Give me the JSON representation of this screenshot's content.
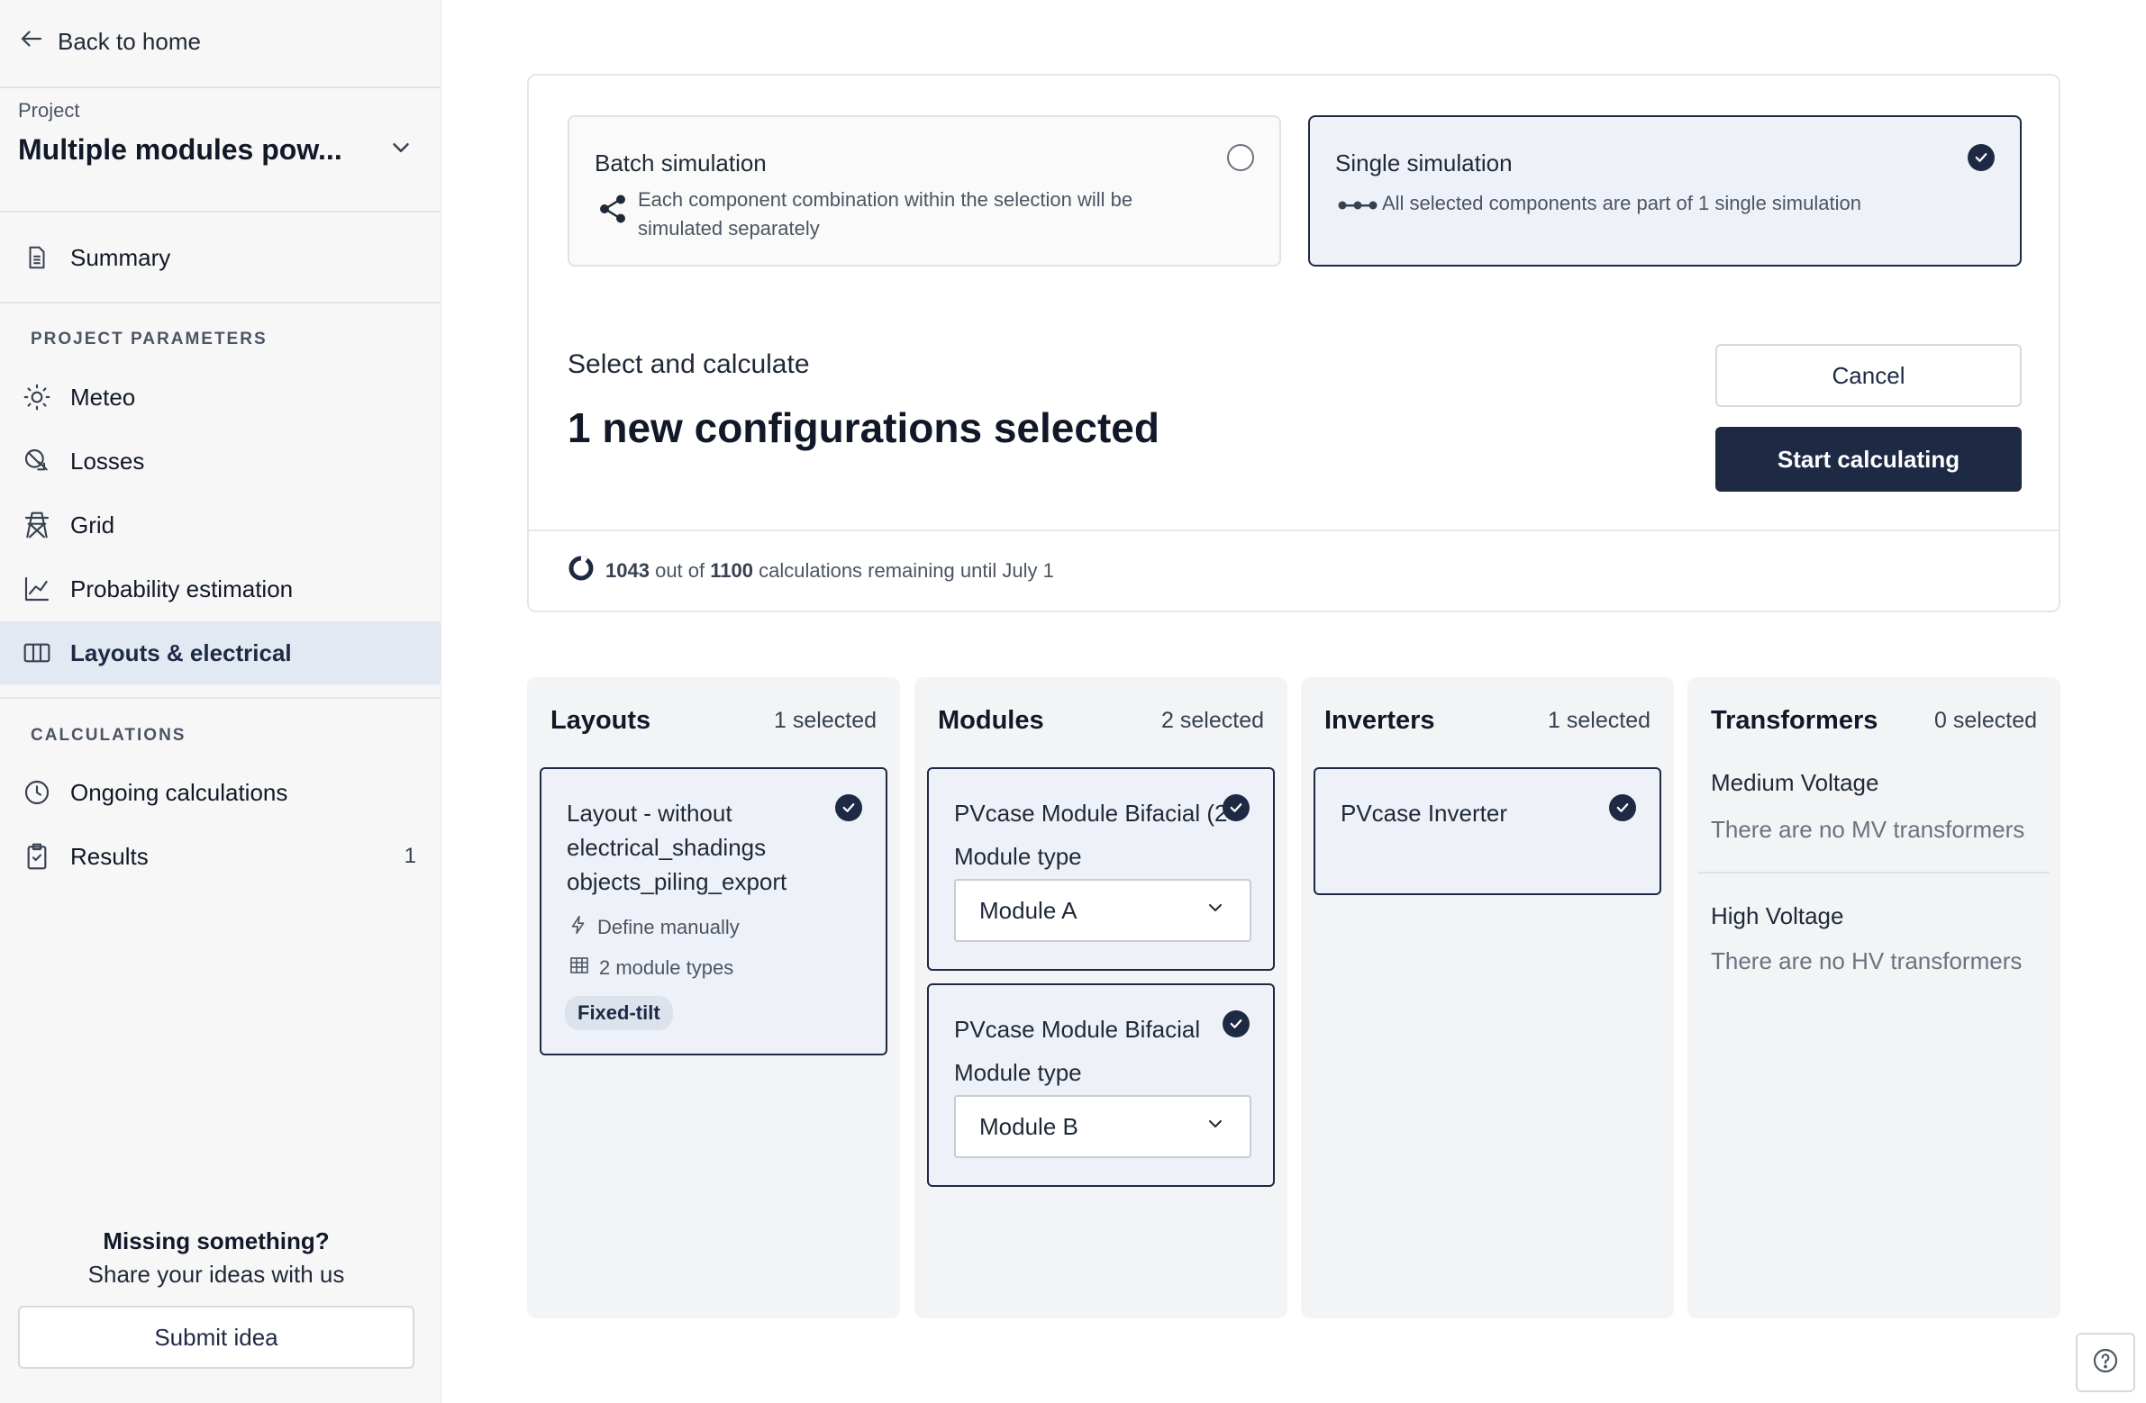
{
  "sidebar": {
    "back_label": "Back to home",
    "project_caption": "Project",
    "project_name": "Multiple modules pow...",
    "summary_label": "Summary",
    "params_section": "PROJECT PARAMETERS",
    "params": [
      {
        "label": "Meteo",
        "icon": "sun-icon"
      },
      {
        "label": "Losses",
        "icon": "losses-icon"
      },
      {
        "label": "Grid",
        "icon": "power-tower-icon"
      },
      {
        "label": "Probability estimation",
        "icon": "line-chart-icon"
      },
      {
        "label": "Layouts & electrical",
        "icon": "columns-icon",
        "active": true
      }
    ],
    "calc_section": "CALCULATIONS",
    "calcs": [
      {
        "label": "Ongoing calculations",
        "icon": "clock-icon"
      },
      {
        "label": "Results",
        "icon": "clipboard-check-icon",
        "count": "1"
      }
    ],
    "missing_title": "Missing something?",
    "missing_sub": "Share your ideas with us",
    "submit_label": "Submit idea"
  },
  "simulation": {
    "batch": {
      "title": "Batch simulation",
      "desc": "Each component combination within the selection will be simulated separately",
      "selected": false
    },
    "single": {
      "title": "Single simulation",
      "desc": "All selected components are part of 1 single simulation",
      "selected": true
    }
  },
  "calculate": {
    "label": "Select and calculate",
    "count_text": "1 new configurations selected",
    "cancel_label": "Cancel",
    "start_label": "Start calculating"
  },
  "quota": {
    "used": "1043",
    "out_of": "out of",
    "total": "1100",
    "suffix": "calculations remaining until July 1"
  },
  "columns": {
    "layouts": {
      "title": "Layouts",
      "count": "1 selected",
      "item": {
        "title": "Layout - without electrical_shadings objects_piling_export",
        "define": "Define manually",
        "module_types": "2 module types",
        "tag": "Fixed-tilt"
      }
    },
    "modules": {
      "title": "Modules",
      "count": "2 selected",
      "field_label": "Module type",
      "items": [
        {
          "title": "PVcase Module Bifacial (2",
          "value": "Module A"
        },
        {
          "title": "PVcase Module Bifacial",
          "value": "Module B"
        }
      ]
    },
    "inverters": {
      "title": "Inverters",
      "count": "1 selected",
      "item": {
        "title": "PVcase Inverter"
      }
    },
    "transformers": {
      "title": "Transformers",
      "count": "0 selected",
      "mv_title": "Medium Voltage",
      "mv_empty": "There are no MV transformers",
      "hv_title": "High Voltage",
      "hv_empty": "There are no HV transformers"
    }
  },
  "colors": {
    "primary": "#1e2a44",
    "active_bg": "#e3e9f3",
    "card_selected_bg": "#eef2f8"
  }
}
